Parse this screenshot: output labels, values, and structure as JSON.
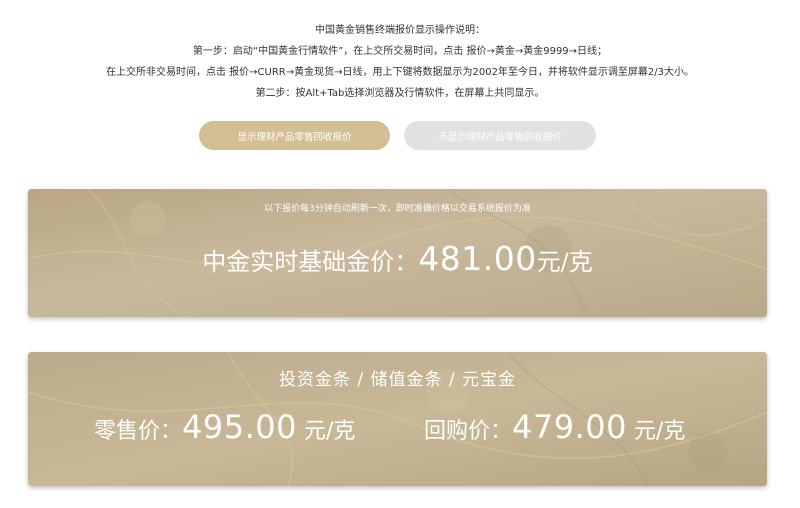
{
  "instructions": {
    "line1": "中国黄金销售终端报价显示操作说明：",
    "line2": "第一步：启动“中国黄金行情软件”，在上交所交易时间，点击 报价→黄金→黄金9999→日线；",
    "line3": "在上交所非交易时间，点击 报价→CURR→黄金现货→日线，用上下键将数据显示为2002年至今日，并将软件显示调至屏幕2/3大小。",
    "line4": "第二步：按Alt+Tab选择浏览器及行情软件，在屏幕上共同显示。"
  },
  "buttons": {
    "show_label": "显示理财产品零售回收报价",
    "hide_label": "不显示理财产品零售回收报价"
  },
  "base_card": {
    "note": "以下报价每3分钟自动刷新一次，即时准确价格以交易系统报价为准",
    "label": "中金实时基础金价：",
    "price": "481.00",
    "unit": "元/克"
  },
  "product_card": {
    "title": "投资金条 / 储值金条 / 元宝金",
    "retail_label": "零售价：",
    "retail_price": "495.00",
    "retail_unit": " 元/克",
    "buyback_label": "回购价：",
    "buyback_price": "479.00",
    "buyback_unit": " 元/克"
  },
  "colors": {
    "button_active": "#d2bf93",
    "button_inactive": "#e2e2e2",
    "card_background": "#c2b193",
    "text_on_card": "#ffffff"
  }
}
